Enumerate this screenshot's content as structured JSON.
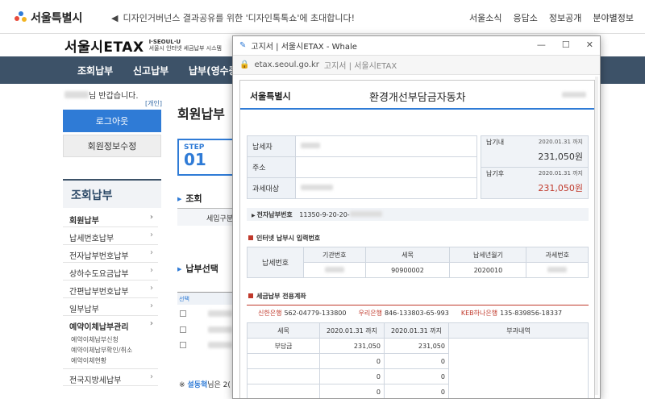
{
  "site": {
    "logo_text": "서울특별시",
    "notice_icon": "megaphone-icon",
    "notice": "디자인거버넌스 결과공유를 위한 '디자인톡톡쇼'에 초대합니다!",
    "utility_links": [
      "서울소식",
      "응답소",
      "정보공개",
      "분야별정보"
    ]
  },
  "etax": {
    "title": "서울시ETAX",
    "sub_line1": "I·SEOUL·U",
    "sub_line2": "서울시 인터넷 세금납부 시스템"
  },
  "gnb": [
    "조회납부",
    "신고납부",
    "납부(영수증"
  ],
  "user": {
    "greeting_suffix": "님 반갑습니다.",
    "mobile_label": "[개인]",
    "logout": "로그아웃",
    "edit_info": "회원정보수정"
  },
  "lnb": {
    "title": "조회납부",
    "items": [
      "회원납부",
      "납세번호납부",
      "전자납부번호납부",
      "상하수도요금납부",
      "간편납부번호납부",
      "일부납부",
      "예약이체납부관리"
    ],
    "subitems": [
      "예약이체납부신청",
      "예약이체납부확인/취소",
      "예약이체현황"
    ],
    "last_item": "전국지방세납부"
  },
  "main": {
    "page_title": "회원납부",
    "step_label": "STEP",
    "step_num": "01",
    "section_inquiry": "조회",
    "tax_type_label": "세입구분",
    "section_select": "납부선택",
    "select_col": "선택",
    "note_prefix": "※",
    "note_bold": "설동혁",
    "note_rest": "님은 2("
  },
  "popup": {
    "title": "고지서 | 서울시ETAX - Whale",
    "window_controls": [
      "—",
      "☐",
      "✕"
    ],
    "address_domain": "etax.seoul.go.kr",
    "address_title": "고지서 | 서울시ETAX",
    "doc": {
      "logo_text": "서울특별시",
      "title": "환경개선부담금자동차",
      "payer_label": "납세자",
      "address_label": "주소",
      "target_label": "과세대상",
      "due_in_label": "납기내",
      "due_in_date": "2020.01.31 까지",
      "due_in_amount": "231,050원",
      "due_after_label": "납기후",
      "due_after_date": "2020.01.31 까지",
      "due_after_amount": "231,050원",
      "epay_label": "전자납부번호",
      "epay_number": "11350-9-20-20-",
      "inet_section": "인터넷 납부시 입력번호",
      "inet_row_label": "납세번호",
      "inet_headers": [
        "기관번호",
        "세목",
        "납세년월기",
        "과세번호"
      ],
      "inet_values": [
        "",
        "90900002",
        "2020010",
        ""
      ],
      "bank_section": "세금납부 전용계좌",
      "banks": [
        {
          "name": "신한은행",
          "account": "562-04779-133800"
        },
        {
          "name": "우리은행",
          "account": "846-133803-65-993"
        },
        {
          "name": "KEB하나은행",
          "account": "135-839856-18337"
        }
      ],
      "tax_headers": [
        "세목",
        "2020.01.31 까지",
        "2020.01.31 까지",
        "부과내역"
      ],
      "tax_rows": [
        [
          "부담금",
          "231,050",
          "231,050"
        ],
        [
          "",
          "0",
          "0"
        ],
        [
          "",
          "0",
          "0"
        ],
        [
          "",
          "0",
          "0"
        ]
      ]
    }
  }
}
